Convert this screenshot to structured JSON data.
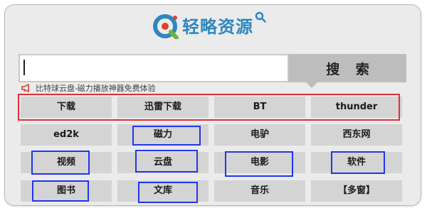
{
  "logo": {
    "text": "轻略资源"
  },
  "search": {
    "value": "",
    "button_label": "搜 索"
  },
  "notice": {
    "text": "比特球云盘-磁力播放神器免费体验"
  },
  "grid": {
    "row0": [
      "下载",
      "迅雷下载",
      "BT",
      "thunder"
    ],
    "row1": [
      "ed2k",
      "磁力",
      "电驴",
      "西东网"
    ],
    "row2": [
      "视频",
      "云盘",
      "电影",
      "软件"
    ],
    "row3": [
      "图书",
      "文库",
      "音乐",
      "【多窗】"
    ]
  },
  "colors": {
    "frame_bg": "#ebebeb",
    "cell_bg": "#d4d4d4",
    "button_bg": "#bdbdbd",
    "logo_blue": "#2e87c0",
    "highlight_red": "#e0303a",
    "highlight_blue": "#2035ee"
  }
}
